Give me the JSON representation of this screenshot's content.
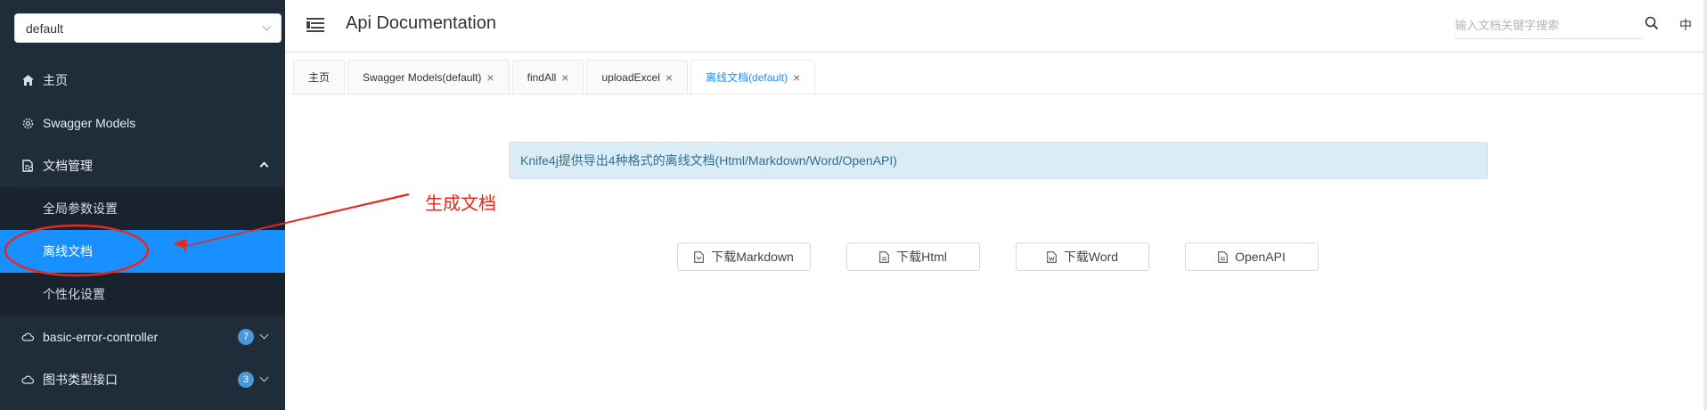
{
  "group_select": {
    "value": "default"
  },
  "sidebar": {
    "items": [
      {
        "label": "主页",
        "icon": "home-icon"
      },
      {
        "label": "Swagger Models",
        "icon": "gear-icon"
      },
      {
        "label": "文档管理",
        "icon": "document-manage-icon",
        "expanded": true,
        "children": [
          {
            "label": "全局参数设置"
          },
          {
            "label": "离线文档",
            "active": true
          },
          {
            "label": "个性化设置"
          }
        ]
      },
      {
        "label": "basic-error-controller",
        "icon": "cloud-icon",
        "badge": "7"
      },
      {
        "label": "图书类型接口",
        "icon": "cloud-icon",
        "badge": "3"
      }
    ]
  },
  "header": {
    "title": "Api Documentation",
    "search_placeholder": "输入文档关键字搜索",
    "lang": "中"
  },
  "tabs": [
    {
      "label": "主页",
      "closable": false
    },
    {
      "label": "Swagger Models(default)",
      "closable": true
    },
    {
      "label": "findAll",
      "closable": true
    },
    {
      "label": "uploadExcel",
      "closable": true
    },
    {
      "label": "离线文档(default)",
      "closable": true,
      "active": true
    }
  ],
  "content": {
    "alert": "Knife4j提供导出4种格式的离线文档(Html/Markdown/Word/OpenAPI)",
    "buttons": [
      {
        "label": "下载Markdown"
      },
      {
        "label": "下载Html"
      },
      {
        "label": "下载Word"
      },
      {
        "label": "OpenAPI"
      }
    ]
  },
  "annotation": {
    "text": "生成文档",
    "color": "#e8281e"
  },
  "colors": {
    "sidebar_bg": "#1f2d3a",
    "active_blue": "#1890ff",
    "alert_bg": "#daedf6",
    "alert_text": "#31708f"
  }
}
